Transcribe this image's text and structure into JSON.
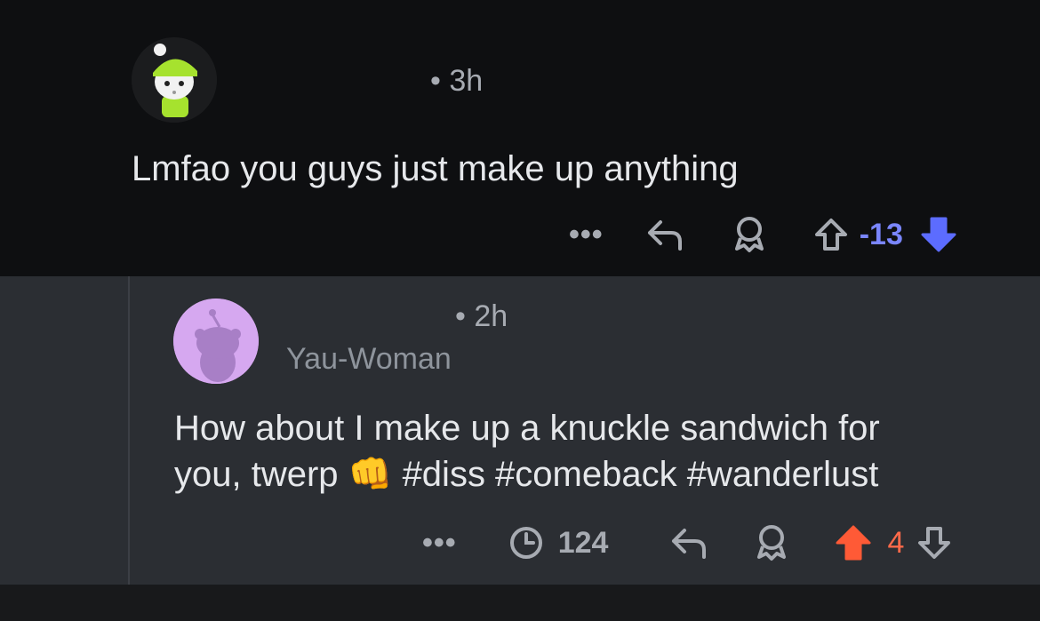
{
  "comments": [
    {
      "time": "• 3h",
      "body": "Lmfao you guys just make up anything",
      "more": "•••",
      "score": "-13",
      "vote_state": "downvoted",
      "score_color": "#7a86ff"
    },
    {
      "time": "• 2h",
      "flair": "Yau-Woman",
      "body_line1": "How about I make up a knuckle sandwich for",
      "body_line2": "you, twerp 👊 #diss #comeback #wanderlust",
      "more": "•••",
      "views": "124",
      "score": "4",
      "vote_state": "upvoted",
      "score_color": "#ff5a36"
    }
  ],
  "icons": [
    "more-icon",
    "reply-icon",
    "award-icon",
    "upvote-icon",
    "downvote-icon",
    "clock-icon"
  ]
}
